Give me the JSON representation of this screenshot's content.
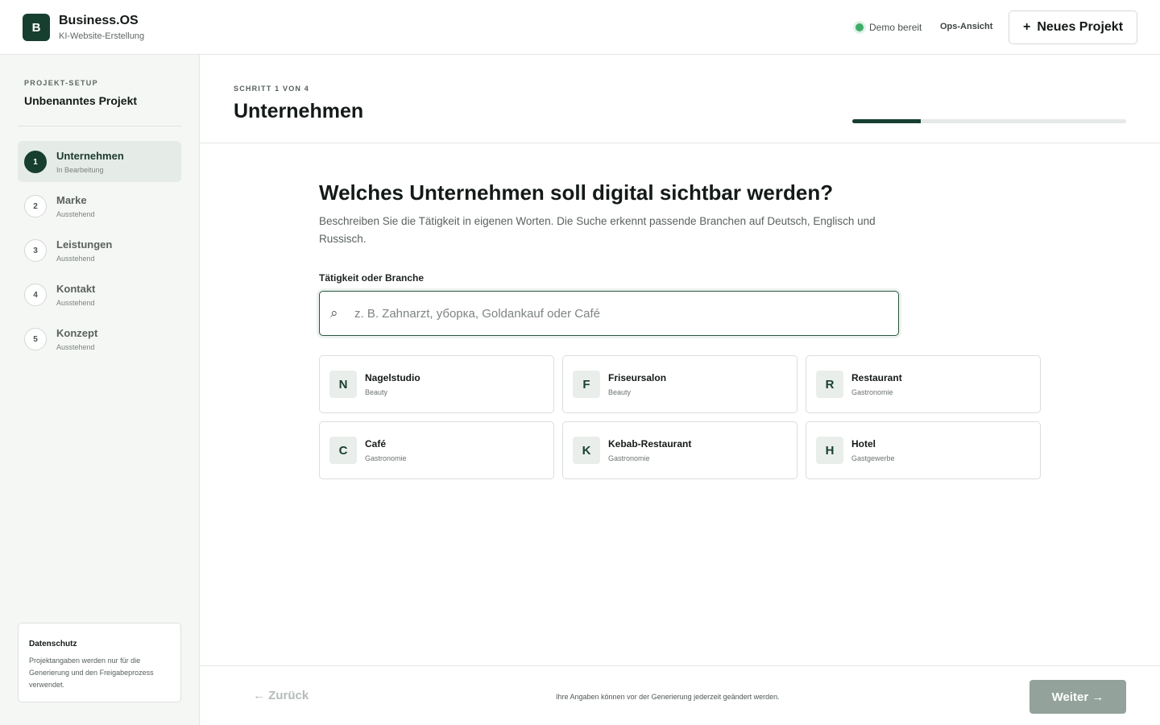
{
  "header": {
    "logo_letter": "B",
    "brand_title": "Business.OS",
    "brand_subtitle": "KI-Website-Erstellung",
    "status_text": "Demo bereit",
    "ops_link": "Ops-Ansicht",
    "new_project_icon": "+",
    "new_project_label": "Neues Projekt"
  },
  "sidebar": {
    "kicker": "PROJEKT-SETUP",
    "project_name": "Unbenanntes Projekt",
    "steps": [
      {
        "number": "1",
        "title": "Unternehmen",
        "status": "In Bearbeitung",
        "active": true
      },
      {
        "number": "2",
        "title": "Marke",
        "status": "Ausstehend",
        "active": false
      },
      {
        "number": "3",
        "title": "Leistungen",
        "status": "Ausstehend",
        "active": false
      },
      {
        "number": "4",
        "title": "Kontakt",
        "status": "Ausstehend",
        "active": false
      },
      {
        "number": "5",
        "title": "Konzept",
        "status": "Ausstehend",
        "active": false
      }
    ],
    "privacy": {
      "title": "Datenschutz",
      "text": "Projektangaben werden nur für die Generierung und den Freigabeprozess verwendet."
    }
  },
  "main": {
    "step_kicker": "SCHRITT 1 VON 4",
    "page_title": "Unternehmen",
    "progress_fraction": 0.25,
    "question": "Welches Unternehmen soll digital sichtbar werden?",
    "description": "Beschreiben Sie die Tätigkeit in eigenen Worten. Die Suche erkennt passende Branchen auf Deutsch, Englisch und Russisch.",
    "field_label": "Tätigkeit oder Branche",
    "search": {
      "icon": "search-icon",
      "value": "",
      "placeholder": "z. B. Zahnarzt, уборка, Goldankauf oder Café"
    },
    "suggestions": [
      {
        "letter": "N",
        "title": "Nagelstudio",
        "category": "Beauty"
      },
      {
        "letter": "F",
        "title": "Friseursalon",
        "category": "Beauty"
      },
      {
        "letter": "R",
        "title": "Restaurant",
        "category": "Gastronomie"
      },
      {
        "letter": "C",
        "title": "Café",
        "category": "Gastronomie"
      },
      {
        "letter": "K",
        "title": "Kebab-Restaurant",
        "category": "Gastronomie"
      },
      {
        "letter": "H",
        "title": "Hotel",
        "category": "Gastgewerbe"
      }
    ]
  },
  "footer": {
    "back_label": "← Zurück",
    "note": "Ihre Angaben können vor der Generierung jederzeit geändert werden.",
    "next_label": "Weiter →"
  },
  "colors": {
    "accent": "#173f30",
    "status_green": "#3eae6a",
    "disabled_button": "#93a29a"
  }
}
